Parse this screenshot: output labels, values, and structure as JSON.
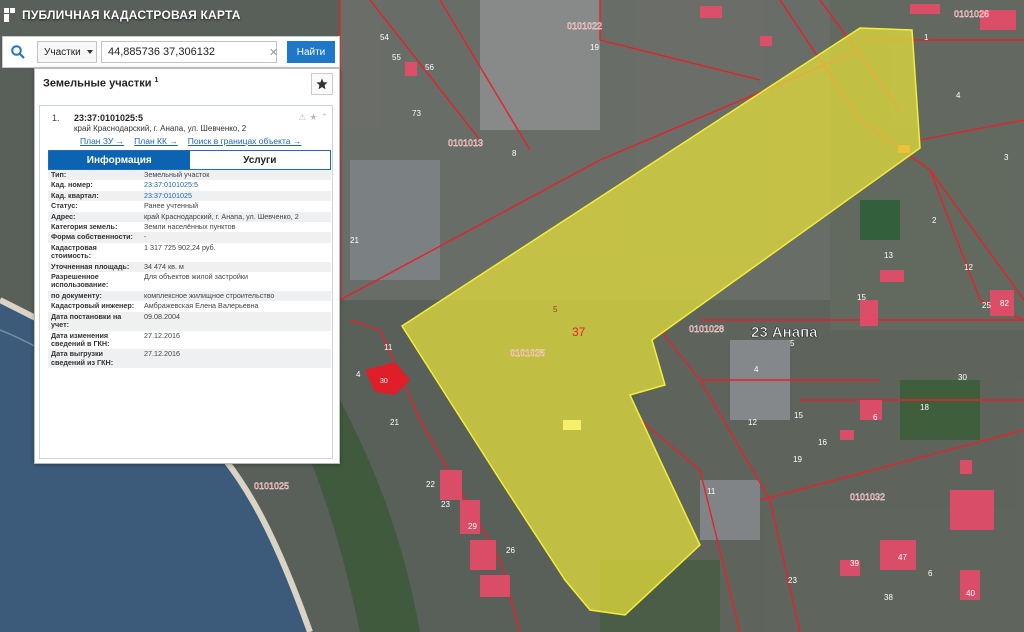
{
  "app": {
    "title": "ПУБЛИЧНАЯ КАДАСТРОВАЯ КАРТА"
  },
  "search": {
    "type_selected": "Участки",
    "query": "44,885736 37,306132",
    "find_label": "Найти"
  },
  "panel": {
    "title": "Земельные участки",
    "count_sup": "1"
  },
  "item": {
    "number": "1.",
    "cad_number": "23:37:0101025:5",
    "address": "край Краснодарский, г. Анапа, ул. Шевченко, 2",
    "links": [
      "План ЗУ →",
      "План КК →",
      "Поиск в границах объекта →"
    ]
  },
  "tabs": {
    "info": "Информация",
    "services": "Услуги"
  },
  "attributes": [
    {
      "key": "Тип:",
      "value": "Земельный участок"
    },
    {
      "key": "Кад. номер:",
      "value": "23:37:0101025:5",
      "link": true
    },
    {
      "key": "Кад. квартал:",
      "value": "23:37:0101025",
      "link": true
    },
    {
      "key": "Статус:",
      "value": "Ранее учтенный"
    },
    {
      "key": "Адрес:",
      "value": "край Краснодарский, г. Анапа, ул. Шевченко, 2"
    },
    {
      "key": "Категория земель:",
      "value": "Земли населённых пунктов"
    },
    {
      "key": "Форма собственности:",
      "value": "-"
    },
    {
      "key": "Кадастровая стоимость:",
      "value": "1 317 725 902,24 руб."
    },
    {
      "key": "Уточненная площадь:",
      "value": "34 474 кв. м"
    },
    {
      "key": "Разрешенное использование:",
      "value": "Для объектов жилой застройки"
    },
    {
      "key": "по документу:",
      "value": "комплексное жилищное строительство"
    },
    {
      "key": "Кадастровый инженер:",
      "value": "Амбражевская Елена Валерьевна"
    },
    {
      "key": "Дата постановки на учет:",
      "value": "09.08.2004"
    },
    {
      "key": "Дата изменения сведений в ГКН:",
      "value": "27.12.2016"
    },
    {
      "key": "Дата выгрузки сведений из ГКН:",
      "value": "27.12.2016"
    }
  ],
  "map": {
    "labels": {
      "anapa": "23 Анапа",
      "parcel_num": "37",
      "parcel_small": "5",
      "q_0101025_a": "0101025",
      "q_0101025_b": "0101025",
      "q_0101022": "0101022",
      "q_0101026": "0101026",
      "q_0101013": "0101013",
      "q_0101028": "0101028",
      "q_0101032": "0101032"
    },
    "numbers": [
      "54",
      "56",
      "55",
      "73",
      "8",
      "1",
      "2",
      "3",
      "4",
      "12",
      "13",
      "82",
      "25",
      "15",
      "22",
      "23",
      "29",
      "26",
      "11",
      "16",
      "39",
      "38",
      "47",
      "23",
      "19",
      "21",
      "11",
      "15",
      "12",
      "21",
      "30",
      "4",
      "18",
      "4",
      "6",
      "40",
      "6",
      "5",
      "19"
    ],
    "colors": {
      "parcel_fill": "#e8e23a",
      "boundary": "#e8202a",
      "water": "#3c5a7a",
      "selected_small": "#e01e2a"
    }
  }
}
